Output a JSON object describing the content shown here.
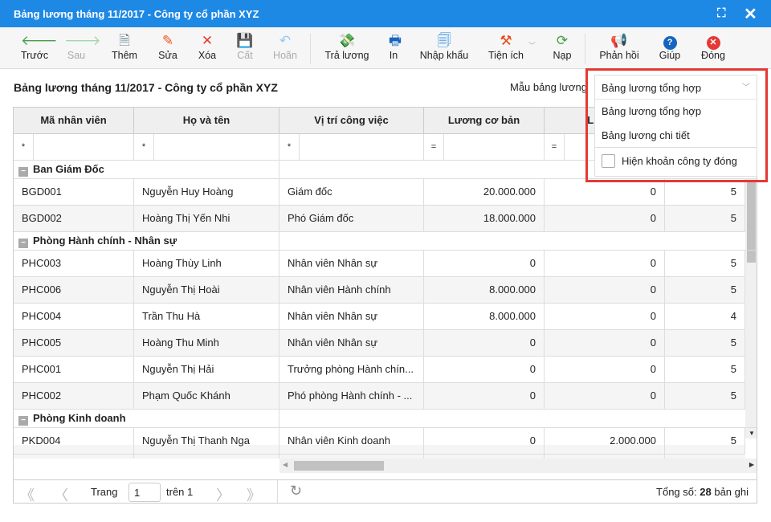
{
  "window": {
    "title": "Bảng lương tháng 11/2017 - Công ty cổ phần XYZ",
    "icons": [
      "maximize-icon",
      "close-icon"
    ]
  },
  "toolbar": [
    {
      "label": "Trước",
      "icon": "arrow-left-icon",
      "enabled": true
    },
    {
      "label": "Sau",
      "icon": "arrow-right-icon",
      "enabled": false
    },
    {
      "label": "Thêm",
      "icon": "add-document-icon",
      "enabled": true
    },
    {
      "label": "Sửa",
      "icon": "edit-icon",
      "enabled": true
    },
    {
      "label": "Xóa",
      "icon": "delete-icon",
      "enabled": true
    },
    {
      "label": "Cất",
      "icon": "save-icon",
      "enabled": false
    },
    {
      "label": "Hoãn",
      "icon": "undo-icon",
      "enabled": false
    },
    {
      "label": "Trả lương",
      "icon": "money-icon",
      "enabled": true
    },
    {
      "label": "In",
      "icon": "print-icon",
      "enabled": true
    },
    {
      "label": "Nhập khẩu",
      "icon": "import-icon",
      "enabled": true
    },
    {
      "label": "Tiện ích",
      "icon": "tools-icon",
      "enabled": true
    },
    {
      "label": "Nạp",
      "icon": "refresh-icon",
      "enabled": true
    },
    {
      "label": "Phản hồi",
      "icon": "megaphone-icon",
      "enabled": true
    },
    {
      "label": "Giúp",
      "icon": "help-icon",
      "enabled": true
    },
    {
      "label": "Đóng",
      "icon": "close-circle-icon",
      "enabled": true
    }
  ],
  "page_title": "Bảng lương tháng 11/2017 - Công ty cổ phần XYZ",
  "template": {
    "label": "Mẫu bảng lương",
    "selected": "Bảng lương tổng hợp",
    "options": [
      "Bảng lương tổng hợp",
      "Bảng lương chi tiết"
    ],
    "checkbox_label": "Hiện khoản công ty đóng",
    "checkbox_checked": false
  },
  "grid": {
    "columns": [
      "Mã nhân viên",
      "Họ và tên",
      "Vị trí công việc",
      "Lương cơ bản",
      "Lương"
    ],
    "filters": [
      "*",
      "*",
      "*",
      "=",
      "="
    ],
    "groups": [
      {
        "name": "Ban Giám Đốc",
        "rows": [
          [
            "BGD001",
            "Nguyễn Huy Hoàng",
            "Giám đốc",
            "20.000.000",
            "0",
            "5"
          ],
          [
            "BGD002",
            "Hoàng Thị Yến Nhi",
            "Phó Giám đốc",
            "18.000.000",
            "0",
            "5"
          ]
        ]
      },
      {
        "name": "Phòng Hành chính - Nhân sự",
        "rows": [
          [
            "PHC003",
            "Hoàng Thùy Linh",
            "Nhân viên Nhân sự",
            "0",
            "0",
            "5"
          ],
          [
            "PHC006",
            "Nguyễn Thị Hoài",
            "Nhân viên Hành chính",
            "8.000.000",
            "0",
            "5"
          ],
          [
            "PHC004",
            "Trần Thu Hà",
            "Nhân viên Nhân sự",
            "8.000.000",
            "0",
            "4"
          ],
          [
            "PHC005",
            "Hoàng Thu Minh",
            "Nhân viên Nhân sự",
            "0",
            "0",
            "5"
          ],
          [
            "PHC001",
            "Nguyễn Thị Hải",
            "Trưởng phòng Hành chín...",
            "0",
            "0",
            "5"
          ],
          [
            "PHC002",
            "Phạm Quốc Khánh",
            "Phó phòng Hành chính - ...",
            "0",
            "0",
            "5"
          ]
        ]
      },
      {
        "name": "Phòng Kinh doanh",
        "rows": [
          [
            "PKD004",
            "Nguyễn Thị Thanh Nga",
            "Nhân viên Kinh doanh",
            "0",
            "2.000.000",
            "5"
          ]
        ]
      }
    ]
  },
  "pager": {
    "page_label": "Trang",
    "page": "1",
    "of_label": "trên 1",
    "total_label": "Tổng số:",
    "total": "28",
    "total_suffix": "bản ghi"
  }
}
